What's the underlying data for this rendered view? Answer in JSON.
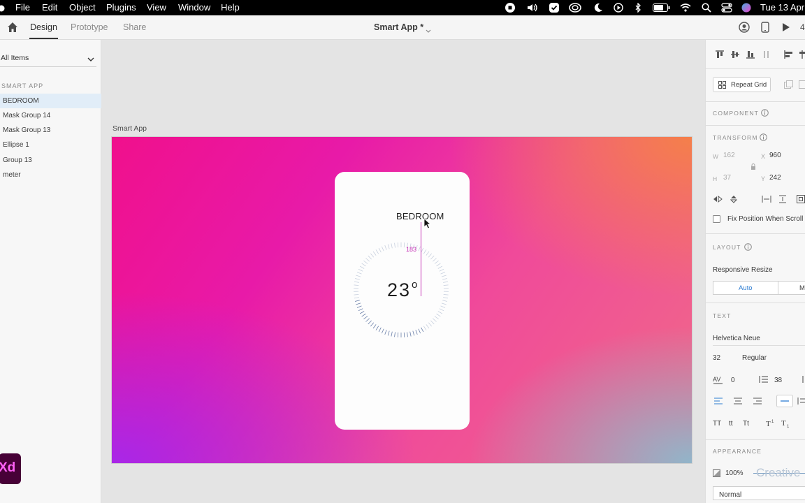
{
  "menubar": {
    "items": [
      "File",
      "Edit",
      "Object",
      "Plugins",
      "View",
      "Window",
      "Help"
    ],
    "datetime": "Tue 13 Apr"
  },
  "toolbar": {
    "tabs": [
      "Design",
      "Prototype",
      "Share"
    ],
    "active_tab": "Design",
    "doc_title": "Smart App *",
    "zoom_partial": "4"
  },
  "layers": {
    "filter_label": "All Items",
    "section_title": "SMART APP",
    "items": [
      {
        "label": "BEDROOM",
        "selected": true
      },
      {
        "label": "Mask Group 14",
        "selected": false
      },
      {
        "label": "Mask Group 13",
        "selected": false
      },
      {
        "label": "Ellipse 1",
        "selected": false
      },
      {
        "label": "Group 13",
        "selected": false
      },
      {
        "label": "meter",
        "selected": false
      }
    ]
  },
  "canvas": {
    "artboard_label": "Smart App",
    "room_label": "BEDROOM",
    "temperature": "23",
    "degree_symbol": "o",
    "guide_measure": "183"
  },
  "inspector": {
    "repeat_grid_label": "Repeat Grid",
    "component_header": "COMPONENT",
    "transform_header": "TRANSFORM",
    "w_label": "W",
    "w_value": "162",
    "x_label": "X",
    "x_value": "960",
    "h_label": "H",
    "h_value": "37",
    "y_label": "Y",
    "y_value": "242",
    "fix_position_label": "Fix Position When Scroll",
    "layout_header": "LAYOUT",
    "responsive_resize_label": "Responsive Resize",
    "responsive_auto": "Auto",
    "responsive_manual_partial": "Ma",
    "text_header": "TEXT",
    "font_family": "Helvetica Neue",
    "font_size": "32",
    "font_weight": "Regular",
    "char_spacing": "0",
    "line_spacing": "38",
    "text_transform_buttons": [
      "TT",
      "tt",
      "Tt"
    ],
    "appearance_header": "APPEARANCE",
    "opacity": "100%",
    "blend_mode": "Normal",
    "creative_overlay": "Creative"
  },
  "brand": {
    "xd_logo": "Xd",
    "colors": {
      "xd_bg": "#470137",
      "xd_fg": "#ff61f6",
      "guide": "#c530b5",
      "selection": "#e1edf8"
    }
  }
}
